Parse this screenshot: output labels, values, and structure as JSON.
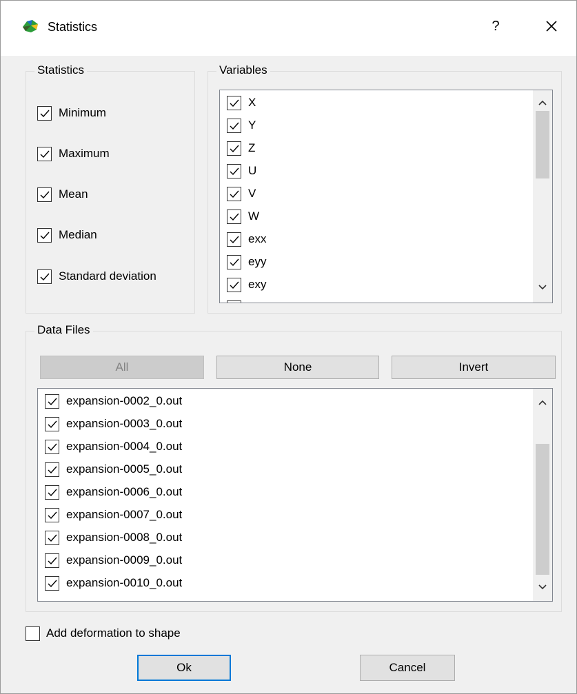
{
  "window": {
    "title": "Statistics",
    "help_label": "?"
  },
  "statistics": {
    "group_title": "Statistics",
    "items": [
      {
        "label": "Minimum",
        "checked": true
      },
      {
        "label": "Maximum",
        "checked": true
      },
      {
        "label": "Mean",
        "checked": true
      },
      {
        "label": "Median",
        "checked": true
      },
      {
        "label": "Standard deviation",
        "checked": true
      }
    ]
  },
  "variables": {
    "group_title": "Variables",
    "items": [
      {
        "label": "X",
        "checked": true
      },
      {
        "label": "Y",
        "checked": true
      },
      {
        "label": "Z",
        "checked": true
      },
      {
        "label": "U",
        "checked": true
      },
      {
        "label": "V",
        "checked": true
      },
      {
        "label": "W",
        "checked": true
      },
      {
        "label": "exx",
        "checked": true
      },
      {
        "label": "eyy",
        "checked": true
      },
      {
        "label": "exy",
        "checked": true
      }
    ]
  },
  "data_files": {
    "group_title": "Data Files",
    "buttons": {
      "all": "All",
      "none": "None",
      "invert": "Invert"
    },
    "items": [
      {
        "label": "expansion-0002_0.out",
        "checked": true
      },
      {
        "label": "expansion-0003_0.out",
        "checked": true
      },
      {
        "label": "expansion-0004_0.out",
        "checked": true
      },
      {
        "label": "expansion-0005_0.out",
        "checked": true
      },
      {
        "label": "expansion-0006_0.out",
        "checked": true
      },
      {
        "label": "expansion-0007_0.out",
        "checked": true
      },
      {
        "label": "expansion-0008_0.out",
        "checked": true
      },
      {
        "label": "expansion-0009_0.out",
        "checked": true
      },
      {
        "label": "expansion-0010_0.out",
        "checked": true
      }
    ]
  },
  "options": {
    "add_deformation_label": "Add deformation to shape",
    "add_deformation_checked": false
  },
  "footer": {
    "ok_label": "Ok",
    "cancel_label": "Cancel"
  },
  "colors": {
    "accent": "#0078d7",
    "background": "#f0f0f0",
    "scroll_thumb": "#cdcdcd"
  }
}
